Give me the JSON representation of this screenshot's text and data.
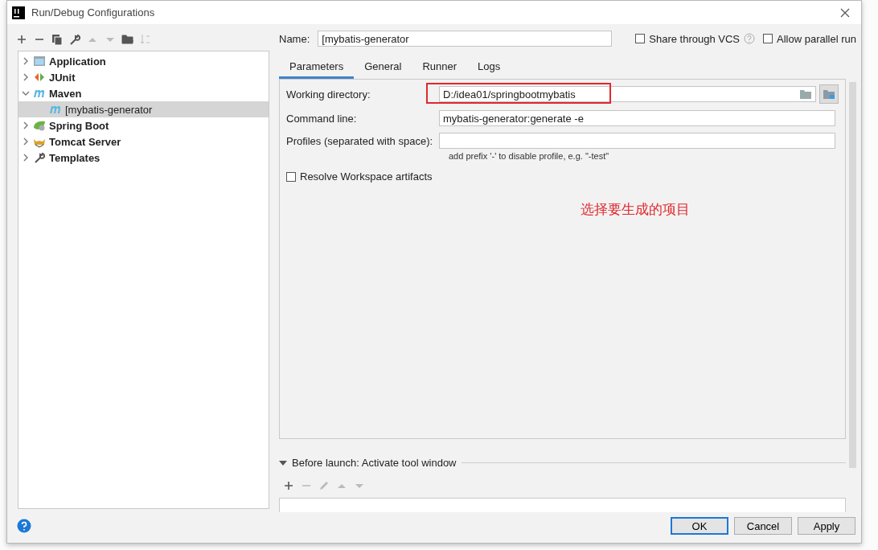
{
  "window": {
    "title": "Run/Debug Configurations"
  },
  "toolbar": [
    {
      "kind": "add",
      "disabled": false
    },
    {
      "kind": "remove",
      "disabled": false
    },
    {
      "kind": "copy",
      "disabled": false
    },
    {
      "kind": "wrench",
      "disabled": false
    },
    {
      "kind": "up",
      "disabled": true
    },
    {
      "kind": "down",
      "disabled": true
    },
    {
      "kind": "folder",
      "disabled": false
    },
    {
      "kind": "sort",
      "disabled": true
    }
  ],
  "tree": [
    {
      "label": "Application",
      "kind": "application",
      "expanded": false,
      "selected": false
    },
    {
      "label": "JUnit",
      "kind": "junit",
      "expanded": false,
      "selected": false
    },
    {
      "label": "Maven",
      "kind": "maven",
      "expanded": true,
      "selected": false,
      "children": [
        {
          "label": "[mybatis-generator",
          "kind": "maven",
          "selected": true
        }
      ]
    },
    {
      "label": "Spring Boot",
      "kind": "spring",
      "expanded": false,
      "selected": false
    },
    {
      "label": "Tomcat Server",
      "kind": "tomcat",
      "expanded": false,
      "selected": false
    },
    {
      "label": "Templates",
      "kind": "wrench",
      "expanded": false,
      "selected": false
    }
  ],
  "name_field": {
    "label": "Name:",
    "value": "[mybatis-generator"
  },
  "options": [
    {
      "label": "Share through VCS",
      "checked": false,
      "help": true
    },
    {
      "label": "Allow parallel run",
      "checked": false,
      "help": false
    }
  ],
  "tabs": [
    {
      "label": "Parameters",
      "selected": true
    },
    {
      "label": "General",
      "selected": false
    },
    {
      "label": "Runner",
      "selected": false
    },
    {
      "label": "Logs",
      "selected": false
    }
  ],
  "fields": [
    {
      "label": "Working directory:",
      "value": "D:/idea01/springbootmybatis",
      "browse": true,
      "highlighted": true
    },
    {
      "label": "Command line:",
      "value": "mybatis-generator:generate -e",
      "browse": false,
      "highlighted": false
    },
    {
      "label": "Profiles (separated with space):",
      "browse": false,
      "highlighted": false,
      "hint": "add prefix '-' to disable profile, e.g. \"-test\""
    }
  ],
  "resolve_workspace": {
    "label": "Resolve Workspace artifacts",
    "checked": false
  },
  "annotation": "选择要生成的项目",
  "before_launch": {
    "title": "Before launch: Activate tool window",
    "expanded": true,
    "toolbar": [
      {
        "kind": "add",
        "disabled": false
      },
      {
        "kind": "remove",
        "disabled": true
      },
      {
        "kind": "edit",
        "disabled": true
      },
      {
        "kind": "up",
        "disabled": true
      },
      {
        "kind": "down",
        "disabled": true
      }
    ]
  },
  "buttons": [
    {
      "label": "OK",
      "default": true
    },
    {
      "label": "Cancel",
      "default": false
    },
    {
      "label": "Apply",
      "default": false
    }
  ]
}
